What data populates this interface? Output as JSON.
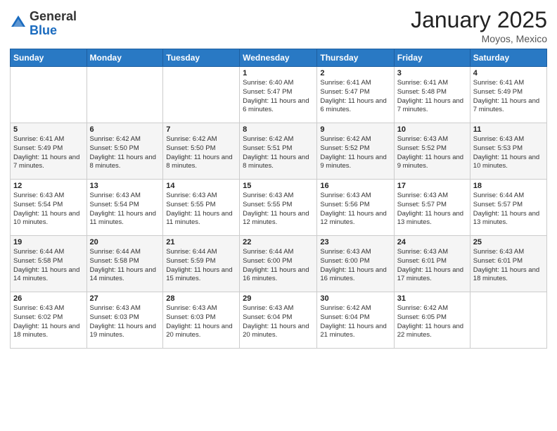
{
  "header": {
    "logo_general": "General",
    "logo_blue": "Blue",
    "title": "January 2025",
    "location": "Moyos, Mexico"
  },
  "days_of_week": [
    "Sunday",
    "Monday",
    "Tuesday",
    "Wednesday",
    "Thursday",
    "Friday",
    "Saturday"
  ],
  "weeks": [
    [
      {
        "day": "",
        "info": ""
      },
      {
        "day": "",
        "info": ""
      },
      {
        "day": "",
        "info": ""
      },
      {
        "day": "1",
        "info": "Sunrise: 6:40 AM\nSunset: 5:47 PM\nDaylight: 11 hours and 6 minutes."
      },
      {
        "day": "2",
        "info": "Sunrise: 6:41 AM\nSunset: 5:47 PM\nDaylight: 11 hours and 6 minutes."
      },
      {
        "day": "3",
        "info": "Sunrise: 6:41 AM\nSunset: 5:48 PM\nDaylight: 11 hours and 7 minutes."
      },
      {
        "day": "4",
        "info": "Sunrise: 6:41 AM\nSunset: 5:49 PM\nDaylight: 11 hours and 7 minutes."
      }
    ],
    [
      {
        "day": "5",
        "info": "Sunrise: 6:41 AM\nSunset: 5:49 PM\nDaylight: 11 hours and 7 minutes."
      },
      {
        "day": "6",
        "info": "Sunrise: 6:42 AM\nSunset: 5:50 PM\nDaylight: 11 hours and 8 minutes."
      },
      {
        "day": "7",
        "info": "Sunrise: 6:42 AM\nSunset: 5:50 PM\nDaylight: 11 hours and 8 minutes."
      },
      {
        "day": "8",
        "info": "Sunrise: 6:42 AM\nSunset: 5:51 PM\nDaylight: 11 hours and 8 minutes."
      },
      {
        "day": "9",
        "info": "Sunrise: 6:42 AM\nSunset: 5:52 PM\nDaylight: 11 hours and 9 minutes."
      },
      {
        "day": "10",
        "info": "Sunrise: 6:43 AM\nSunset: 5:52 PM\nDaylight: 11 hours and 9 minutes."
      },
      {
        "day": "11",
        "info": "Sunrise: 6:43 AM\nSunset: 5:53 PM\nDaylight: 11 hours and 10 minutes."
      }
    ],
    [
      {
        "day": "12",
        "info": "Sunrise: 6:43 AM\nSunset: 5:54 PM\nDaylight: 11 hours and 10 minutes."
      },
      {
        "day": "13",
        "info": "Sunrise: 6:43 AM\nSunset: 5:54 PM\nDaylight: 11 hours and 11 minutes."
      },
      {
        "day": "14",
        "info": "Sunrise: 6:43 AM\nSunset: 5:55 PM\nDaylight: 11 hours and 11 minutes."
      },
      {
        "day": "15",
        "info": "Sunrise: 6:43 AM\nSunset: 5:55 PM\nDaylight: 11 hours and 12 minutes."
      },
      {
        "day": "16",
        "info": "Sunrise: 6:43 AM\nSunset: 5:56 PM\nDaylight: 11 hours and 12 minutes."
      },
      {
        "day": "17",
        "info": "Sunrise: 6:43 AM\nSunset: 5:57 PM\nDaylight: 11 hours and 13 minutes."
      },
      {
        "day": "18",
        "info": "Sunrise: 6:44 AM\nSunset: 5:57 PM\nDaylight: 11 hours and 13 minutes."
      }
    ],
    [
      {
        "day": "19",
        "info": "Sunrise: 6:44 AM\nSunset: 5:58 PM\nDaylight: 11 hours and 14 minutes."
      },
      {
        "day": "20",
        "info": "Sunrise: 6:44 AM\nSunset: 5:58 PM\nDaylight: 11 hours and 14 minutes."
      },
      {
        "day": "21",
        "info": "Sunrise: 6:44 AM\nSunset: 5:59 PM\nDaylight: 11 hours and 15 minutes."
      },
      {
        "day": "22",
        "info": "Sunrise: 6:44 AM\nSunset: 6:00 PM\nDaylight: 11 hours and 16 minutes."
      },
      {
        "day": "23",
        "info": "Sunrise: 6:43 AM\nSunset: 6:00 PM\nDaylight: 11 hours and 16 minutes."
      },
      {
        "day": "24",
        "info": "Sunrise: 6:43 AM\nSunset: 6:01 PM\nDaylight: 11 hours and 17 minutes."
      },
      {
        "day": "25",
        "info": "Sunrise: 6:43 AM\nSunset: 6:01 PM\nDaylight: 11 hours and 18 minutes."
      }
    ],
    [
      {
        "day": "26",
        "info": "Sunrise: 6:43 AM\nSunset: 6:02 PM\nDaylight: 11 hours and 18 minutes."
      },
      {
        "day": "27",
        "info": "Sunrise: 6:43 AM\nSunset: 6:03 PM\nDaylight: 11 hours and 19 minutes."
      },
      {
        "day": "28",
        "info": "Sunrise: 6:43 AM\nSunset: 6:03 PM\nDaylight: 11 hours and 20 minutes."
      },
      {
        "day": "29",
        "info": "Sunrise: 6:43 AM\nSunset: 6:04 PM\nDaylight: 11 hours and 20 minutes."
      },
      {
        "day": "30",
        "info": "Sunrise: 6:42 AM\nSunset: 6:04 PM\nDaylight: 11 hours and 21 minutes."
      },
      {
        "day": "31",
        "info": "Sunrise: 6:42 AM\nSunset: 6:05 PM\nDaylight: 11 hours and 22 minutes."
      },
      {
        "day": "",
        "info": ""
      }
    ]
  ]
}
